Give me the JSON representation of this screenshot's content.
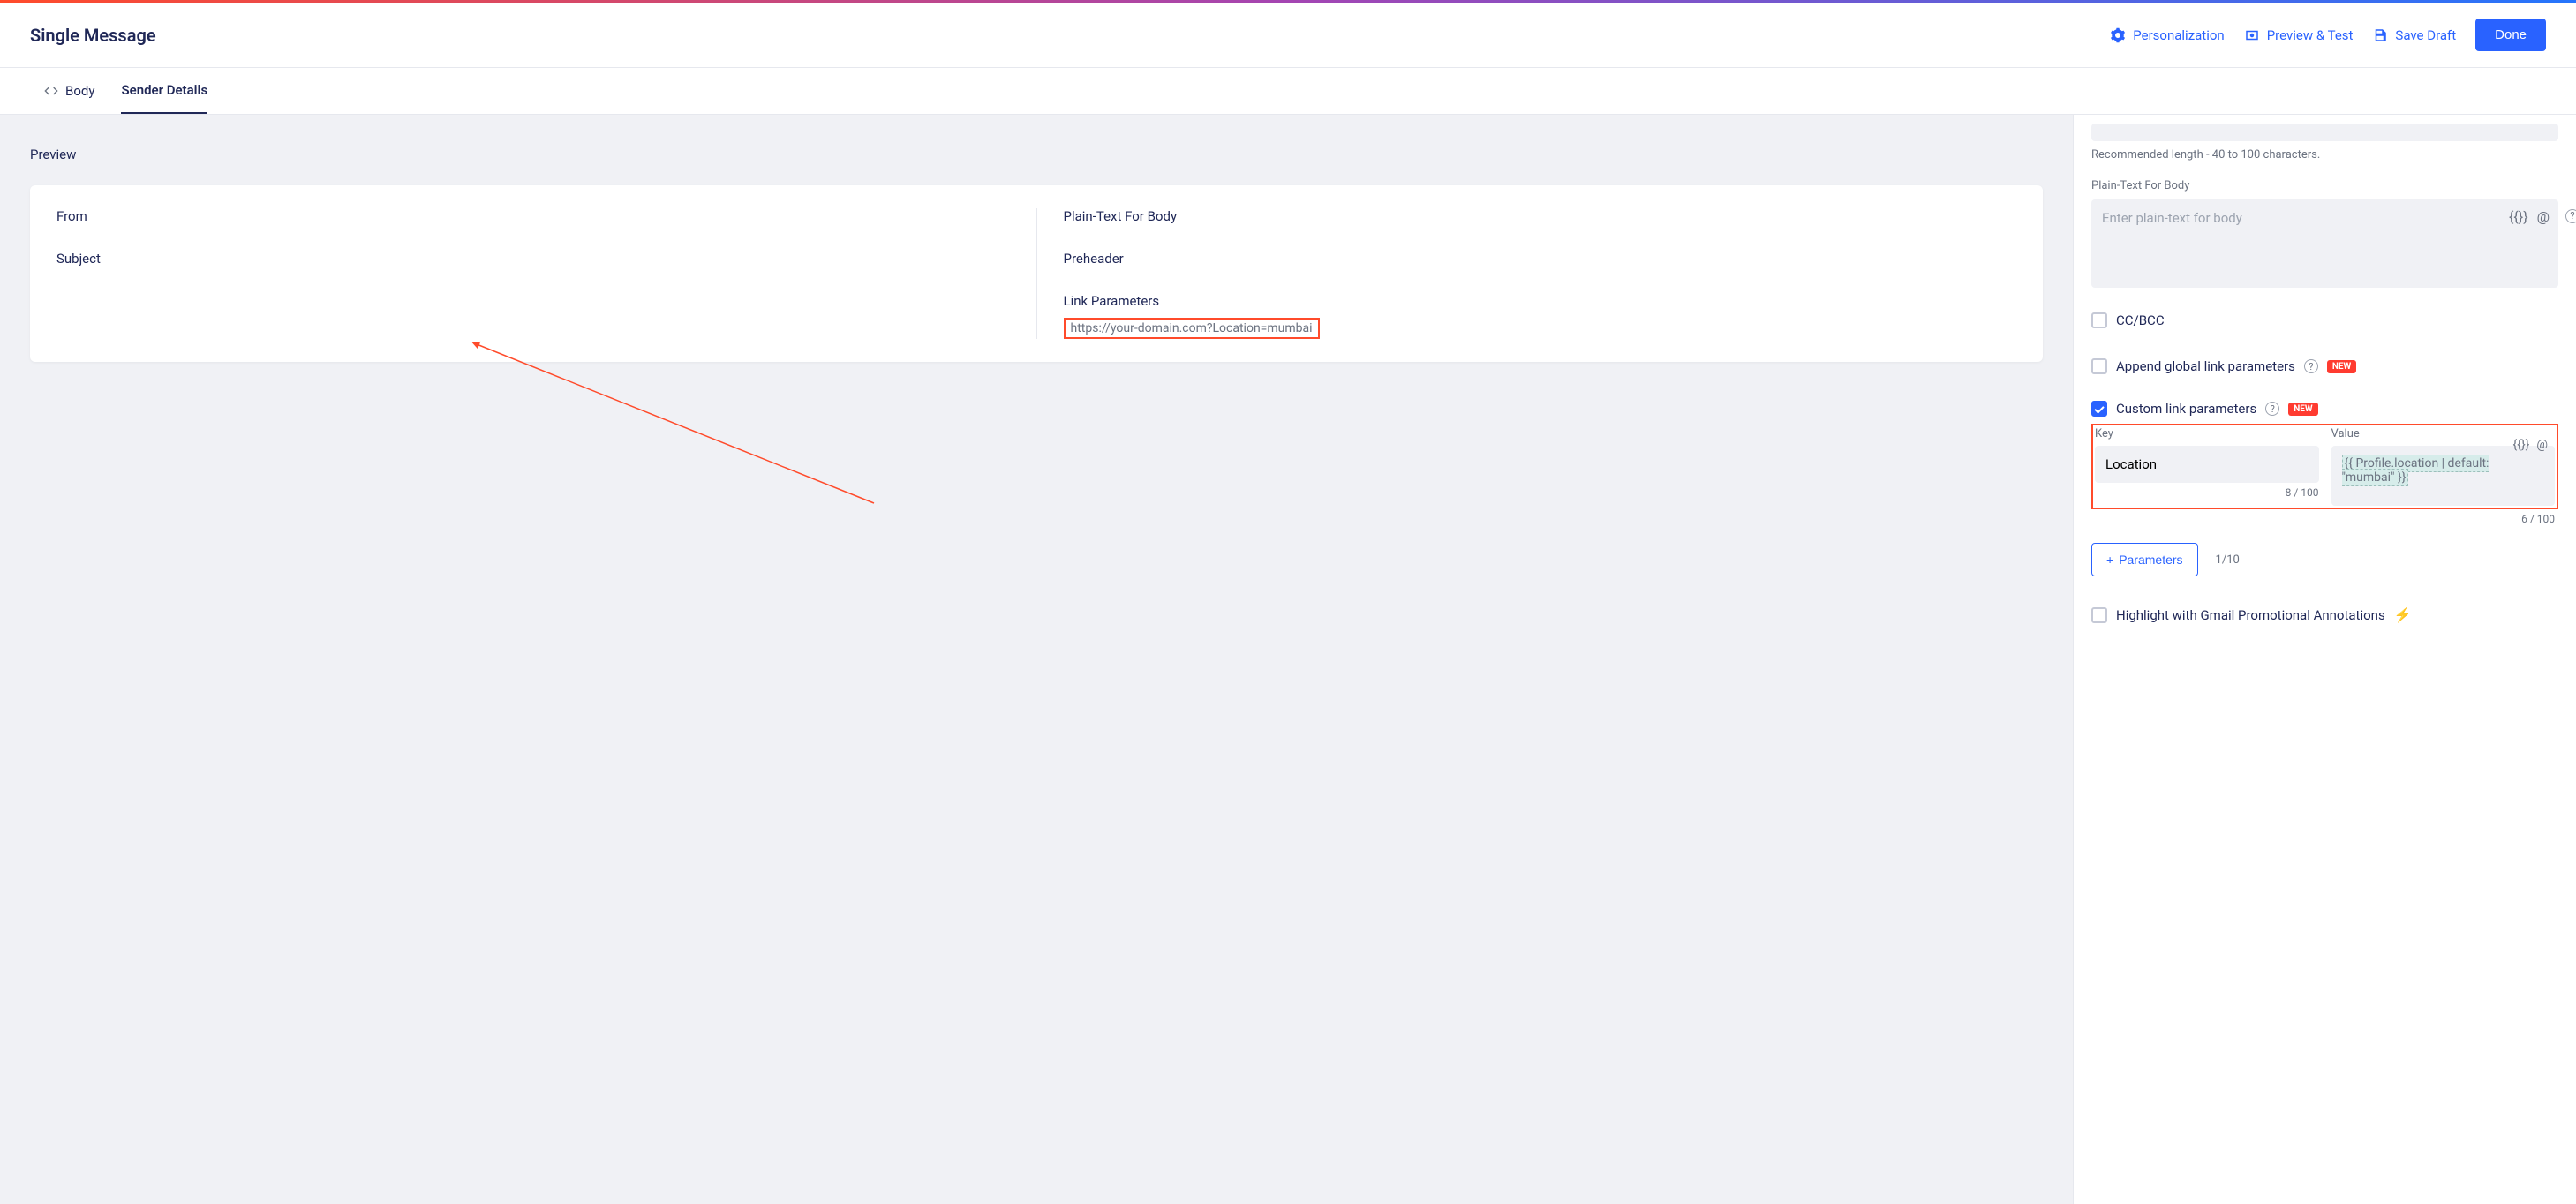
{
  "header": {
    "title": "Single Message",
    "personalization": "Personalization",
    "preview_test": "Preview & Test",
    "save_draft": "Save Draft",
    "done": "Done"
  },
  "tabs": {
    "body": "Body",
    "sender_details": "Sender Details"
  },
  "preview": {
    "label": "Preview",
    "from_label": "From",
    "subject_label": "Subject",
    "plain_text_label": "Plain-Text For Body",
    "preheader_label": "Preheader",
    "link_params_label": "Link Parameters",
    "link_url": "https://your-domain.com?Location=mumbai"
  },
  "sidebar": {
    "recommended_hint": "Recommended length - 40 to 100 characters.",
    "plain_text_label": "Plain-Text For Body",
    "plain_text_placeholder": "Enter plain-text for body",
    "cc_bcc": "CC/BCC",
    "append_global": "Append global link parameters",
    "custom_link": "Custom link parameters",
    "new_badge": "NEW",
    "key_label": "Key",
    "value_label": "Value",
    "key_value": "Location",
    "key_counter": "8 / 100",
    "value_text": "{{ Profile.location | default: \"mumbai\" }}",
    "value_counter": "6 / 100",
    "add_params": "Parameters",
    "params_count": "1/10",
    "gmail_promo": "Highlight with Gmail Promotional Annotations"
  }
}
